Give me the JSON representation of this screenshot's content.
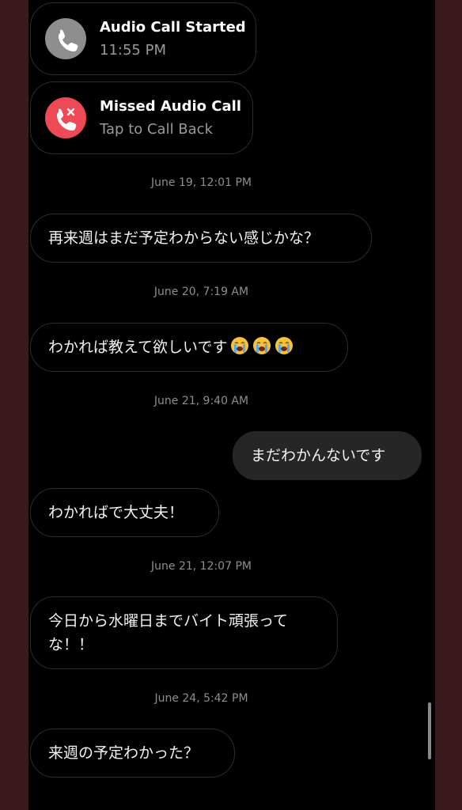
{
  "calls": [
    {
      "title": "Audio Call Started",
      "subtitle": "11:55 PM",
      "icon": "phone-icon",
      "color": "#8e8e8e"
    },
    {
      "title": "Missed Audio Call",
      "subtitle": "Tap to Call Back",
      "icon": "missed-call-icon",
      "color": "#ed4956"
    }
  ],
  "timestamps": [
    "June 19, 12:01 PM",
    "June 20, 7:19 AM",
    "June 21, 9:40 AM",
    "June 21, 12:07 PM",
    "June 24, 5:42 PM"
  ],
  "messages": [
    {
      "text": "再来週はまだ予定わからない感じかな？",
      "direction": "incoming"
    },
    {
      "text": "わかれば教えて欲しいです",
      "emoji": [
        "loudly-crying-face",
        "loudly-crying-face",
        "loudly-crying-face"
      ],
      "direction": "incoming"
    },
    {
      "text": "まだわかんないです",
      "direction": "outgoing"
    },
    {
      "text": "わかればで大丈夫！",
      "direction": "incoming"
    },
    {
      "line1": "今日から水曜日までバイト頑張って",
      "line2": "な！！",
      "direction": "incoming"
    },
    {
      "text": "来週の予定わかった？",
      "direction": "incoming"
    }
  ]
}
